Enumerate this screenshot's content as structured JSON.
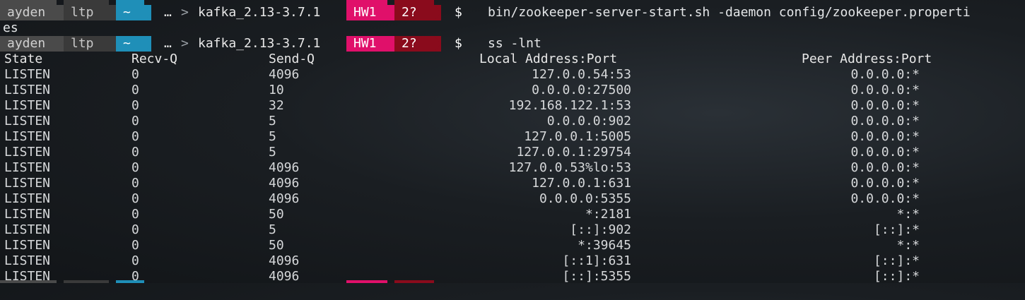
{
  "prompt": {
    "user": "ayden",
    "host": "ltp",
    "home": "~",
    "ellipsis": "…",
    "dir": "kafka_2.13-3.7.1",
    "branch": "HW1",
    "dirty": "2?",
    "symbol": "$"
  },
  "commands": [
    {
      "text": "bin/zookeeper-server-start.sh -daemon config/zookeeper.properti",
      "wrap": "es"
    },
    {
      "text": "ss -lnt"
    }
  ],
  "table": {
    "headers": [
      "State",
      "Recv-Q",
      "Send-Q",
      "Local Address:Port",
      "Peer Address:Port"
    ],
    "rows": [
      {
        "state": "LISTEN",
        "recv": "0",
        "send": "4096",
        "local": "127.0.0.54:53",
        "peer": "0.0.0.0:*"
      },
      {
        "state": "LISTEN",
        "recv": "0",
        "send": "10",
        "local": "0.0.0.0:27500",
        "peer": "0.0.0.0:*"
      },
      {
        "state": "LISTEN",
        "recv": "0",
        "send": "32",
        "local": "192.168.122.1:53",
        "peer": "0.0.0.0:*"
      },
      {
        "state": "LISTEN",
        "recv": "0",
        "send": "5",
        "local": "0.0.0.0:902",
        "peer": "0.0.0.0:*"
      },
      {
        "state": "LISTEN",
        "recv": "0",
        "send": "5",
        "local": "127.0.0.1:5005",
        "peer": "0.0.0.0:*"
      },
      {
        "state": "LISTEN",
        "recv": "0",
        "send": "5",
        "local": "127.0.0.1:29754",
        "peer": "0.0.0.0:*"
      },
      {
        "state": "LISTEN",
        "recv": "0",
        "send": "4096",
        "local": "127.0.0.53%lo:53",
        "peer": "0.0.0.0:*"
      },
      {
        "state": "LISTEN",
        "recv": "0",
        "send": "4096",
        "local": "127.0.0.1:631",
        "peer": "0.0.0.0:*"
      },
      {
        "state": "LISTEN",
        "recv": "0",
        "send": "4096",
        "local": "0.0.0.0:5355",
        "peer": "0.0.0.0:*"
      },
      {
        "state": "LISTEN",
        "recv": "0",
        "send": "50",
        "local": "*:2181",
        "peer": "*:*"
      },
      {
        "state": "LISTEN",
        "recv": "0",
        "send": "5",
        "local": "[::]:902",
        "peer": "[::]:*"
      },
      {
        "state": "LISTEN",
        "recv": "0",
        "send": "50",
        "local": "*:39645",
        "peer": "*:*"
      },
      {
        "state": "LISTEN",
        "recv": "0",
        "send": "4096",
        "local": "[::1]:631",
        "peer": "[::]:*"
      },
      {
        "state": "LISTEN",
        "recv": "0",
        "send": "4096",
        "local": "[::]:5355",
        "peer": "[::]:*"
      }
    ]
  },
  "colors": {
    "user_bg": "#4a4a4a",
    "host_bg": "#3a3a3a",
    "home_bg": "#1f8fb8",
    "branch_bg": "#e0106a",
    "dirty_bg": "#8a0b1c"
  }
}
